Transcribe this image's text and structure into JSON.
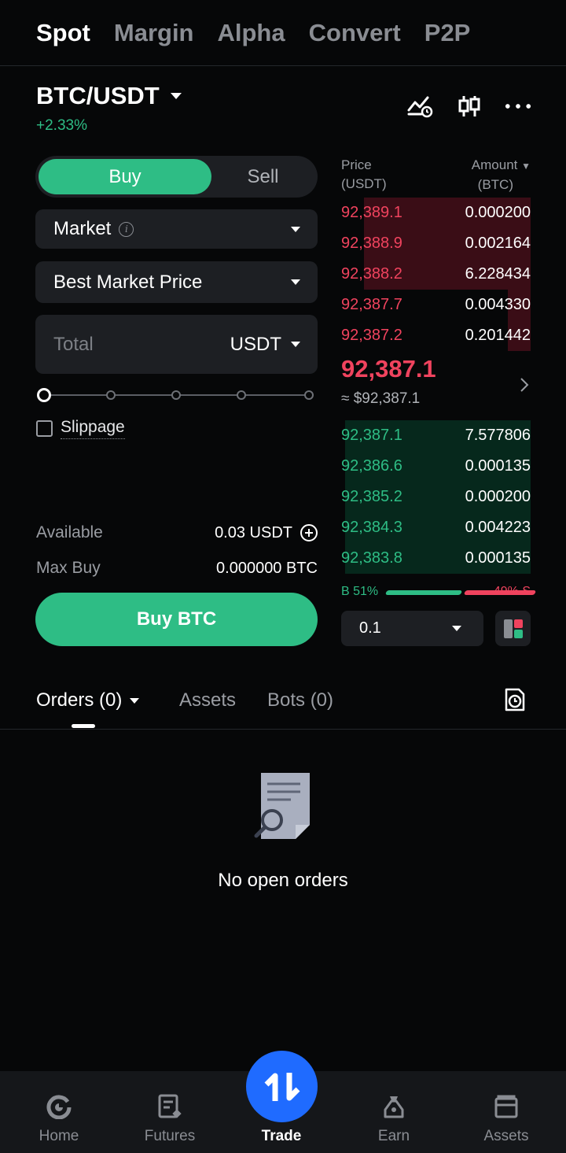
{
  "top_tabs": [
    "Spot",
    "Margin",
    "Alpha",
    "Convert",
    "P2P"
  ],
  "pair": {
    "name": "BTC/USDT",
    "change": "+2.33%"
  },
  "order_form": {
    "buy_label": "Buy",
    "sell_label": "Sell",
    "order_type": "Market",
    "price_mode": "Best Market Price",
    "total_placeholder": "Total",
    "total_unit": "USDT",
    "slider_percent": 0,
    "slippage_label": "Slippage",
    "available_label": "Available",
    "available_value": "0.03 USDT",
    "max_buy_label": "Max Buy",
    "max_buy_value": "0.000000 BTC",
    "submit_label": "Buy BTC"
  },
  "order_book": {
    "price_header": [
      "Price",
      "(USDT)"
    ],
    "amount_header": [
      "Amount",
      "(BTC)"
    ],
    "asks": [
      {
        "price": "92,389.1",
        "amount": "0.000200",
        "depth": 0.88
      },
      {
        "price": "92,388.9",
        "amount": "0.002164",
        "depth": 0.88
      },
      {
        "price": "92,388.2",
        "amount": "6.228434",
        "depth": 0.88
      },
      {
        "price": "92,387.7",
        "amount": "0.004330",
        "depth": 0.12
      },
      {
        "price": "92,387.2",
        "amount": "0.201442",
        "depth": 0.12
      }
    ],
    "mid_price": "92,387.1",
    "mid_usd": "≈ $92,387.1",
    "bids": [
      {
        "price": "92,387.1",
        "amount": "7.577806",
        "depth": 0.98
      },
      {
        "price": "92,386.6",
        "amount": "0.000135",
        "depth": 0.98
      },
      {
        "price": "92,385.2",
        "amount": "0.000200",
        "depth": 0.98
      },
      {
        "price": "92,384.3",
        "amount": "0.004223",
        "depth": 0.98
      },
      {
        "price": "92,383.8",
        "amount": "0.000135",
        "depth": 0.98
      }
    ],
    "buy_ratio_label": "B 51%",
    "sell_ratio_label": "49% S",
    "buy_ratio": 51,
    "sell_ratio": 49,
    "precision": "0.1"
  },
  "orders": {
    "tabs": [
      "Orders (0)",
      "Assets",
      "Bots (0)"
    ],
    "empty_text": "No open orders"
  },
  "bottom_nav": [
    "Home",
    "Futures",
    "Trade",
    "Earn",
    "Assets"
  ],
  "colors": {
    "green": "#2ebd85",
    "red": "#f0435e",
    "accent": "#1f6bff"
  }
}
